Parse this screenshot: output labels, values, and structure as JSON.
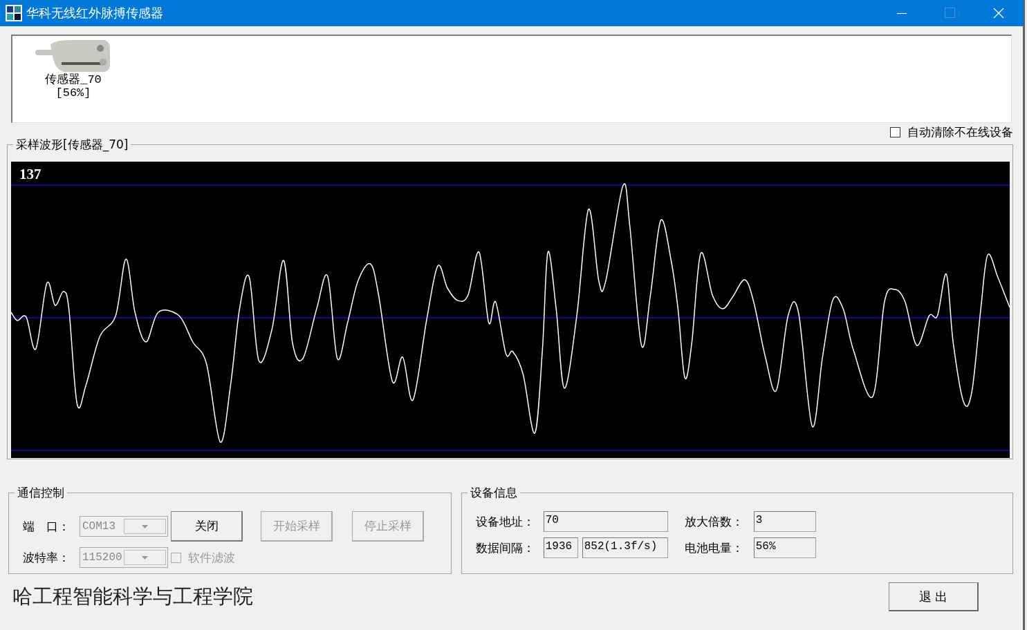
{
  "window": {
    "title": "华科无线红外脉搏传感器"
  },
  "devices": [
    {
      "name": "传感器_70",
      "battery": "[56%]"
    }
  ],
  "auto_clear": {
    "label": "自动清除不在线设备",
    "checked": false
  },
  "waveform": {
    "title": "采样波形[传感器_70]",
    "value": "137"
  },
  "comm": {
    "title": "通信控制",
    "port": {
      "label": "端　口：",
      "value": "COM13",
      "disabled": true
    },
    "baud": {
      "label": "波特率：",
      "value": "115200",
      "disabled": true
    },
    "buttons": [
      {
        "label": "关闭",
        "disabled": false
      },
      {
        "label": "开始采样",
        "disabled": true
      },
      {
        "label": "停止采样",
        "disabled": true
      }
    ],
    "filter": {
      "label": "软件滤波",
      "checked": false,
      "disabled": true
    }
  },
  "device_info": {
    "title": "设备信息",
    "address": {
      "label": "设备地址：",
      "value": "70"
    },
    "gain": {
      "label": "放大倍数：",
      "value": "3"
    },
    "interval": {
      "label": "数据间隔：",
      "values": [
        "1936",
        "852(1.3f/s)"
      ]
    },
    "battery": {
      "label": "电池电量：",
      "value": "56%"
    }
  },
  "footer": {
    "school": "哈工程智能科学与工程学院",
    "exit_button": "退 出"
  }
}
